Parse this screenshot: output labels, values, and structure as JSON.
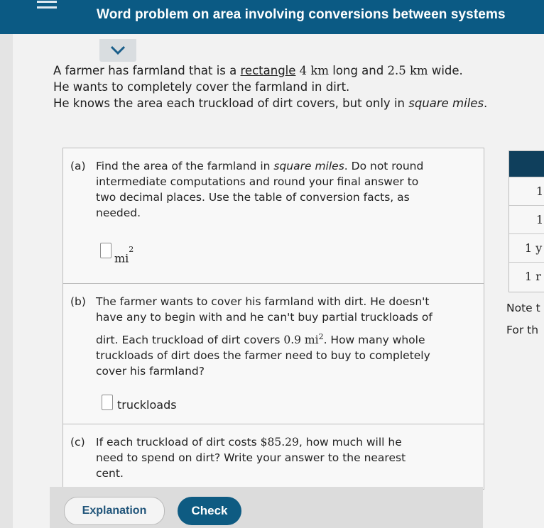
{
  "header": {
    "title": "Word problem on area involving conversions between systems"
  },
  "problem": {
    "line1_pre": "A farmer has farmland that is a ",
    "line1_link": "rectangle",
    "line1_len": "4 km",
    "line1_mid": " long and ",
    "line1_wid": "2.5 km",
    "line1_post": " wide.",
    "line2": "He wants to completely cover the farmland in dirt.",
    "line3_pre": "He knows the area each truckload of dirt covers, but only in ",
    "line3_it": "square miles",
    "line3_post": "."
  },
  "part_a": {
    "label": "(a)",
    "l1_pre": "Find the area of the farmland in ",
    "l1_it": "square miles",
    "l1_post": ". Do not round",
    "l2": "intermediate computations and round your final answer to",
    "l3": "two decimal places. Use the table of conversion facts, as",
    "l4": "needed.",
    "unit": "mi",
    "unit_exp": "2"
  },
  "part_b": {
    "label": "(b)",
    "l1": "The farmer wants to cover his farmland with dirt. He doesn't",
    "l2": "have any to begin with and he can't buy partial truckloads of",
    "l3_pre": "dirt. Each truckload of dirt covers ",
    "l3_val": "0.9 mi",
    "l3_exp": "2",
    "l3_post": ". How many whole",
    "l4": "truckloads of dirt does the farmer need to buy to completely",
    "l5": "cover his farmland?",
    "unit": "truckloads"
  },
  "part_c": {
    "label": "(c)",
    "l1_pre": "If each truckload of dirt costs ",
    "l1_val": "$85.29",
    "l1_post": ", how much will he",
    "l2": "need to spend on dirt? Write your answer to the nearest",
    "l3": "cent."
  },
  "side": {
    "rows": [
      "1",
      "1",
      "1 y",
      "1 r"
    ],
    "note1": "Note t",
    "note2": "For th"
  },
  "buttons": {
    "explanation": "Explanation",
    "check": "Check"
  },
  "colors": {
    "header": "#0b5a84",
    "check_button": "#0e5b82",
    "explanation_text": "#21557a"
  }
}
